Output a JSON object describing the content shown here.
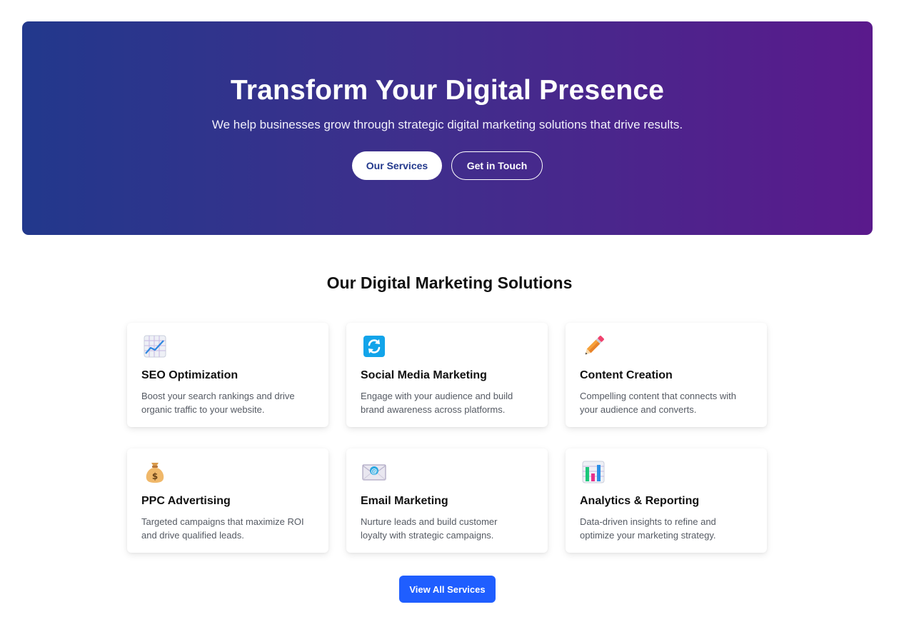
{
  "hero": {
    "title": "Transform Your Digital Presence",
    "subtitle": "We help businesses grow through strategic digital marketing solutions that drive results.",
    "primary_button": "Our Services",
    "secondary_button": "Get in Touch",
    "gradient_start": "#22388c",
    "gradient_end": "#5a1a8c"
  },
  "services": {
    "title": "Our Digital Marketing Solutions",
    "items": [
      {
        "icon": "chart-increasing-icon",
        "title": "SEO Optimization",
        "description": "Boost your search rankings and drive organic traffic to your website."
      },
      {
        "icon": "refresh-arrows-icon",
        "title": "Social Media Marketing",
        "description": "Engage with your audience and build brand awareness across platforms."
      },
      {
        "icon": "pencil-icon",
        "title": "Content Creation",
        "description": "Compelling content that connects with your audience and converts."
      },
      {
        "icon": "money-bag-icon",
        "title": "PPC Advertising",
        "description": "Targeted campaigns that maximize ROI and drive qualified leads."
      },
      {
        "icon": "email-envelope-icon",
        "title": "Email Marketing",
        "description": "Nurture leads and build customer loyalty with strategic campaigns."
      },
      {
        "icon": "bar-chart-icon",
        "title": "Analytics & Reporting",
        "description": "Data-driven insights to refine and optimize your marketing strategy."
      }
    ],
    "view_all_button": "View All Services",
    "accent_color": "#1f5eff"
  }
}
